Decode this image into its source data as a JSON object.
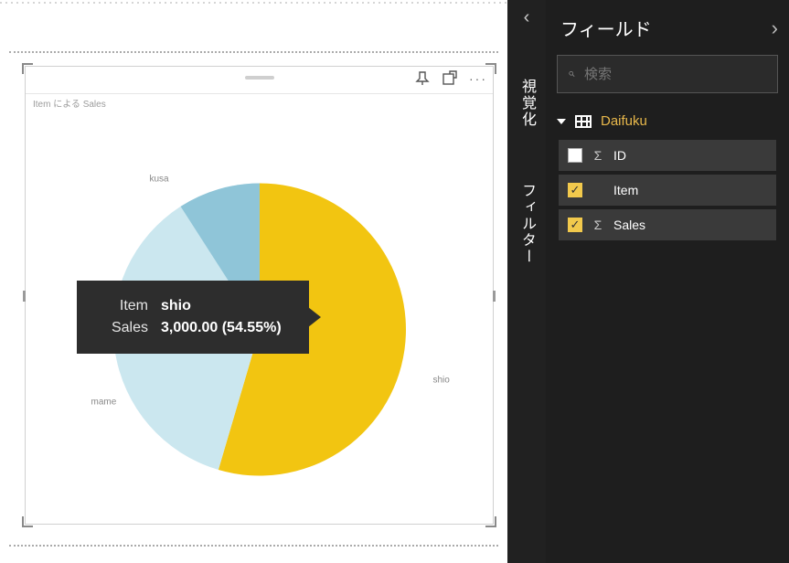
{
  "chart_data": {
    "type": "pie",
    "title": "Item による Sales",
    "series_measure": "Sales",
    "legend_field": "Item",
    "slices": [
      {
        "item": "shio",
        "value": 3000.0,
        "percent": 54.55,
        "color": "#f2c511"
      },
      {
        "item": "mame",
        "value": 2000.0,
        "percent": 36.36,
        "color": "#cbe7ef"
      },
      {
        "item": "kusa",
        "value": 500.0,
        "percent": 9.09,
        "color": "#8fc5d8"
      }
    ]
  },
  "canvas": {
    "pin_tooltip": "ピン留め",
    "focus_tooltip": "フォーカス",
    "more_tooltip": "その他"
  },
  "tooltip": {
    "rows": [
      {
        "label": "Item",
        "value": "shio"
      },
      {
        "label": "Sales",
        "value": "3,000.00 (54.55%)"
      }
    ]
  },
  "collapsed_panels": [
    {
      "label": "視覚化"
    },
    {
      "label": "フィルター"
    }
  ],
  "fields_panel": {
    "title": "フィールド",
    "search_placeholder": "検索",
    "table": {
      "name": "Daifuku",
      "expanded": true
    },
    "fields": [
      {
        "label": "ID",
        "checked": false,
        "has_sigma": true
      },
      {
        "label": "Item",
        "checked": true,
        "has_sigma": false
      },
      {
        "label": "Sales",
        "checked": true,
        "has_sigma": true
      }
    ]
  }
}
